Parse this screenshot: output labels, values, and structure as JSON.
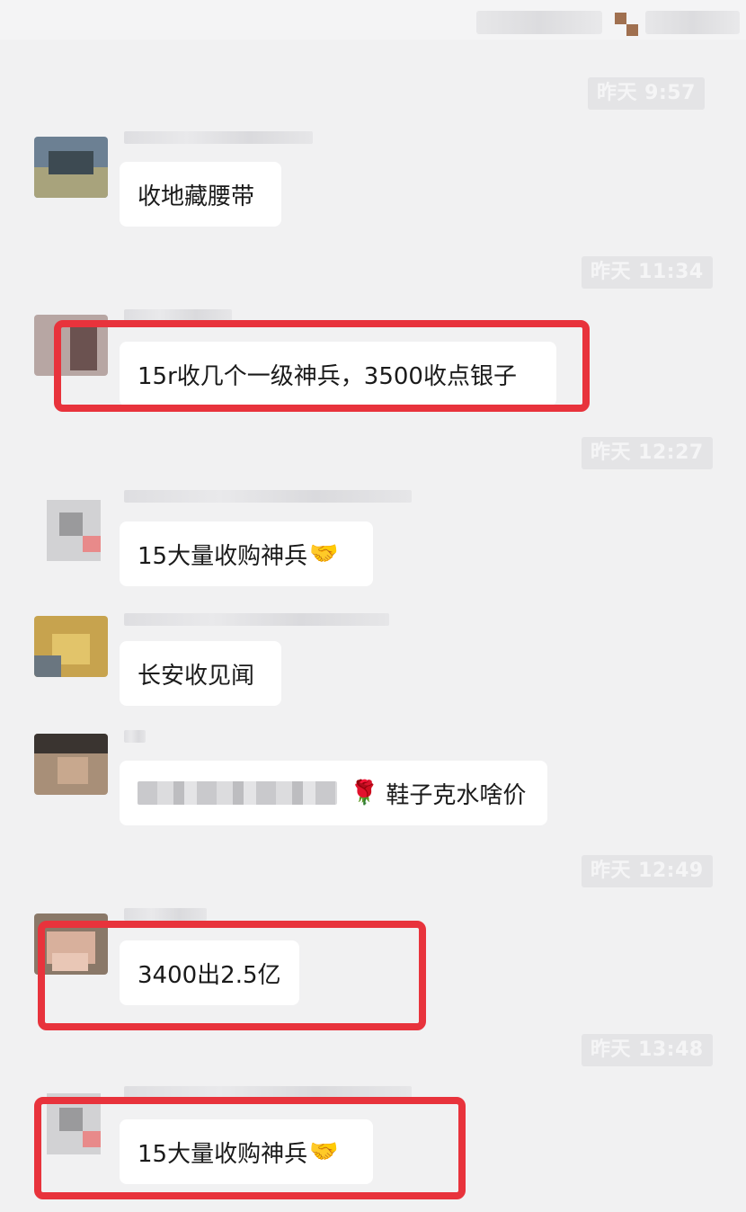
{
  "top_bar": {
    "status_text": ""
  },
  "messages": [
    {
      "time": "昨天 9:57",
      "text": "收地藏腰带",
      "emoji": ""
    },
    {
      "time": "昨天 11:34",
      "text": "15r收几个一级神兵，3500收点银子",
      "emoji": ""
    },
    {
      "time": "昨天 12:27",
      "text": "15大量收购神兵",
      "emoji": "🤝"
    },
    {
      "time": "",
      "text": "长安收见闻",
      "emoji": ""
    },
    {
      "time": "",
      "text": "鞋子克水啥价",
      "emoji": "🌹"
    },
    {
      "time": "昨天 12:49",
      "text": "3400出2.5亿",
      "emoji": ""
    },
    {
      "time": "昨天 13:48",
      "text": "15大量收购神兵",
      "emoji": "🤝"
    }
  ],
  "colors": {
    "background": "#f1f1f2",
    "bubble": "#ffffff",
    "timestamp_bg": "#e4e4e6",
    "highlight": "#e8333c"
  },
  "icons": {
    "handshake": "handshake-emoji",
    "rose": "rose-emoji"
  }
}
